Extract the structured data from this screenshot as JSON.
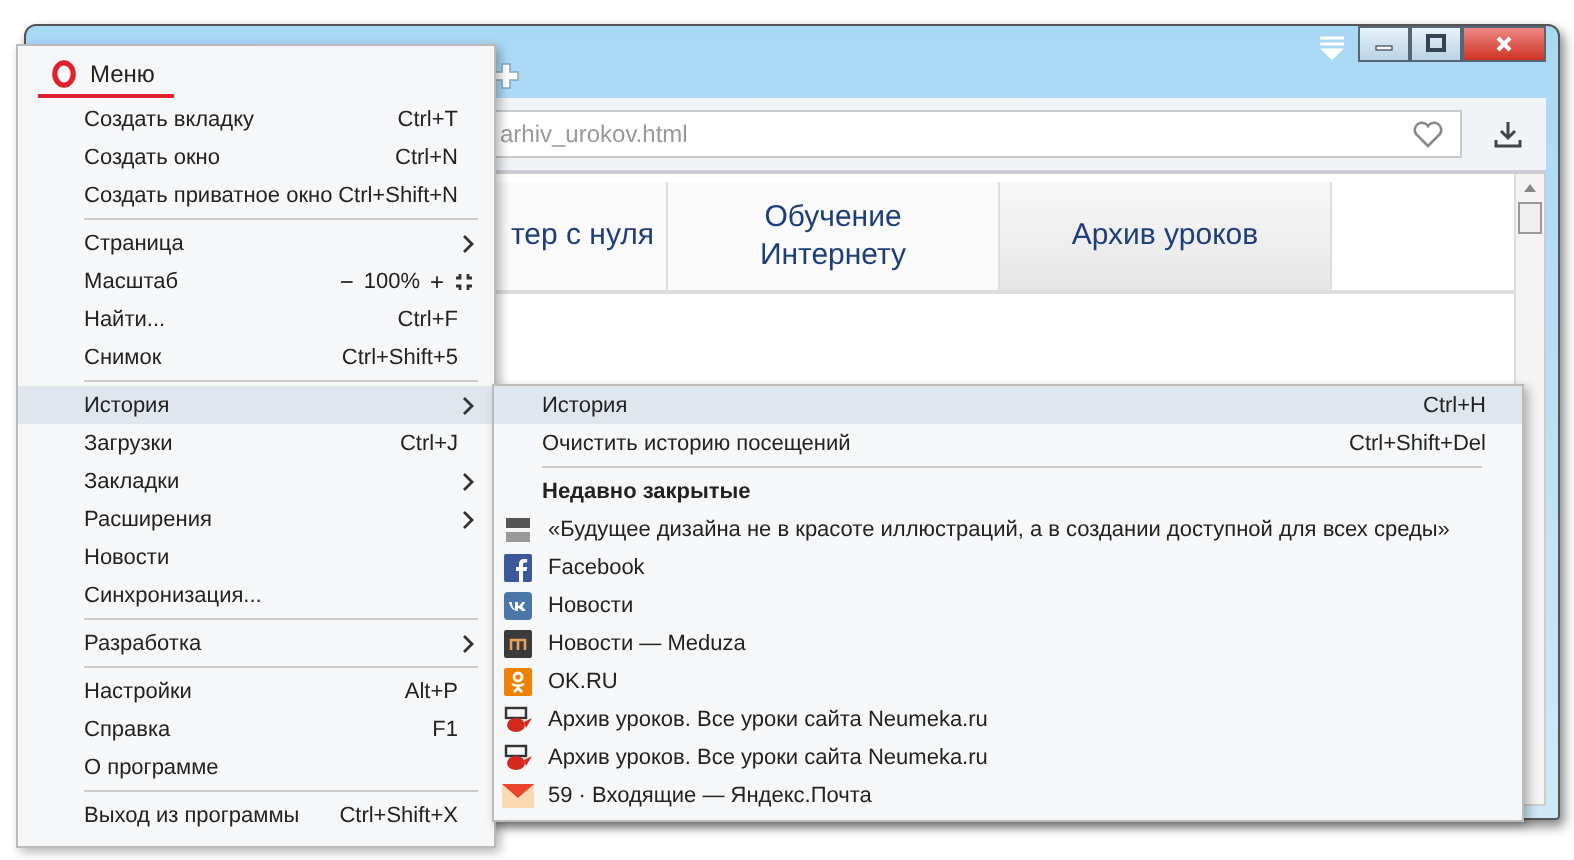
{
  "address_bar": {
    "url": "arhiv_urokov.html"
  },
  "site_nav": [
    {
      "label": "тер с нуля",
      "selected": false
    },
    {
      "label": "Обучение Интернету",
      "selected": false
    },
    {
      "label": "Архив уроков",
      "selected": true
    }
  ],
  "menu": {
    "title": "Меню",
    "sections": [
      [
        {
          "label": "Создать вкладку",
          "kind": "shortcut",
          "shortcut": "Ctrl+T",
          "selected": false
        },
        {
          "label": "Создать окно",
          "kind": "shortcut",
          "shortcut": "Ctrl+N",
          "selected": false
        },
        {
          "label": "Создать приватное окно",
          "kind": "shortcut",
          "shortcut": "Ctrl+Shift+N",
          "selected": false
        }
      ],
      [
        {
          "label": "Страница",
          "kind": "submenu",
          "selected": false
        },
        {
          "label": "Масштаб",
          "kind": "zoom",
          "minus": "−",
          "value": "100%",
          "plus": "+",
          "selected": false
        },
        {
          "label": "Найти...",
          "kind": "shortcut",
          "shortcut": "Ctrl+F",
          "selected": false
        },
        {
          "label": "Снимок",
          "kind": "shortcut",
          "shortcut": "Ctrl+Shift+5",
          "selected": false
        }
      ],
      [
        {
          "label": "История",
          "kind": "submenu",
          "selected": true
        },
        {
          "label": "Загрузки",
          "kind": "shortcut",
          "shortcut": "Ctrl+J",
          "selected": false
        },
        {
          "label": "Закладки",
          "kind": "submenu",
          "selected": false
        },
        {
          "label": "Расширения",
          "kind": "submenu",
          "selected": false
        },
        {
          "label": "Новости",
          "kind": "plain",
          "selected": false
        },
        {
          "label": "Синхронизация...",
          "kind": "plain",
          "selected": false
        }
      ],
      [
        {
          "label": "Разработка",
          "kind": "submenu",
          "selected": false
        }
      ],
      [
        {
          "label": "Настройки",
          "kind": "shortcut",
          "shortcut": "Alt+P",
          "selected": false
        },
        {
          "label": "Справка",
          "kind": "shortcut",
          "shortcut": "F1",
          "selected": false
        },
        {
          "label": "О программе",
          "kind": "plain",
          "selected": false
        }
      ],
      [
        {
          "label": "Выход из программы",
          "kind": "shortcut",
          "shortcut": "Ctrl+Shift+X",
          "selected": false
        }
      ]
    ]
  },
  "history_submenu": {
    "actions": [
      {
        "label": "История",
        "shortcut": "Ctrl+H",
        "selected": true
      },
      {
        "label": "Очистить историю посещений",
        "shortcut": "Ctrl+Shift+Del",
        "selected": false
      }
    ],
    "heading": "Недавно закрытые",
    "recent": [
      {
        "label": "«Будущее дизайна не в красоте иллюстраций, а в создании доступной для всех среды»",
        "kind": "site"
      },
      {
        "label": "Facebook",
        "kind": "facebook"
      },
      {
        "label": "Новости",
        "kind": "vk"
      },
      {
        "label": "Новости — Meduza",
        "kind": "meduza"
      },
      {
        "label": "OK.RU",
        "kind": "ok"
      },
      {
        "label": "Архив уроков. Все уроки сайта Neumeka.ru",
        "kind": "teapot"
      },
      {
        "label": "Архив уроков. Все уроки сайта Neumeka.ru",
        "kind": "teapot"
      },
      {
        "label": "59 · Входящие — Яндекс.Почта",
        "kind": "mail"
      }
    ]
  }
}
